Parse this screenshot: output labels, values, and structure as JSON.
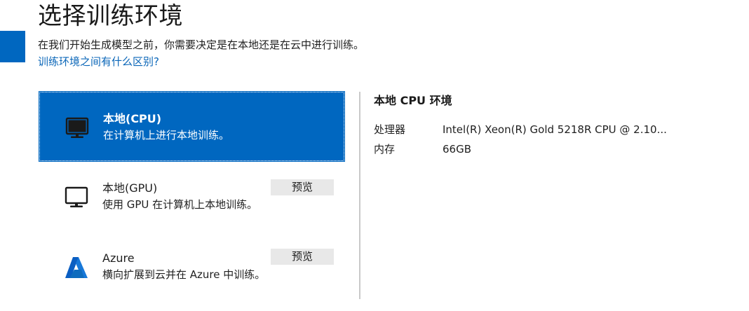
{
  "header": {
    "title": "选择训练环境",
    "description": "在我们开始生成模型之前，你需要决定是在本地还是在云中进行训练。",
    "help_link": "训练环境之间有什么区别?"
  },
  "options": [
    {
      "id": "local-cpu",
      "title": "本地(CPU)",
      "subtitle": "在计算机上进行本地训练。",
      "icon": "monitor-icon",
      "selected": true,
      "badge": ""
    },
    {
      "id": "local-gpu",
      "title": "本地(GPU)",
      "subtitle": "使用 GPU 在计算机上本地训练。",
      "icon": "monitor-icon",
      "selected": false,
      "badge": "预览"
    },
    {
      "id": "azure",
      "title": "Azure",
      "subtitle": "横向扩展到云并在 Azure 中训练。",
      "icon": "azure-logo-icon",
      "selected": false,
      "badge": "预览"
    }
  ],
  "details": {
    "heading": "本地 CPU 环境",
    "processor_label": "处理器",
    "processor_value": "Intel(R) Xeon(R) Gold 5218R CPU @ 2.10...",
    "memory_label": "内存",
    "memory_value": "66GB"
  },
  "colors": {
    "accent": "#0067c0",
    "link": "#0a66b8",
    "badge_bg": "#e8e8e8",
    "divider": "#c9c9c9"
  }
}
